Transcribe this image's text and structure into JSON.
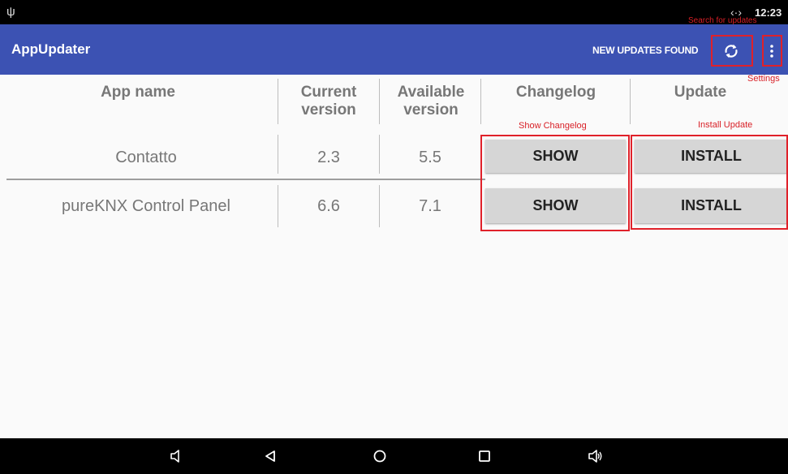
{
  "statusbar": {
    "time": "12:23",
    "usb_icon": "usb-icon",
    "vibrate_icon": "vibrate-icon"
  },
  "appbar": {
    "title": "AppUpdater",
    "updates_status": "NEW UPDATES FOUND",
    "refresh_icon": "refresh-icon",
    "menu_icon": "overflow-menu-icon",
    "color": "#3c52b3"
  },
  "annotations": {
    "search": "Search for updates",
    "settings": "Settings",
    "changelog": "Show Changelog",
    "install": "Install Update",
    "color": "#e0212a"
  },
  "table": {
    "headers": {
      "app_name": "App name",
      "current_version_line1": "Current",
      "current_version_line2": "version",
      "available_version_line1": "Available",
      "available_version_line2": "version",
      "changelog": "Changelog",
      "update": "Update"
    },
    "rows": [
      {
        "name": "Contatto",
        "current": "2.3",
        "available": "5.5",
        "changelog_button": "SHOW",
        "install_button": "INSTALL"
      },
      {
        "name": "pureKNX Control Panel",
        "current": "6.6",
        "available": "7.1",
        "changelog_button": "SHOW",
        "install_button": "INSTALL"
      }
    ]
  },
  "navbar": {
    "icons": [
      "volume-down-icon",
      "back-icon",
      "home-icon",
      "recents-icon",
      "volume-up-icon"
    ]
  }
}
